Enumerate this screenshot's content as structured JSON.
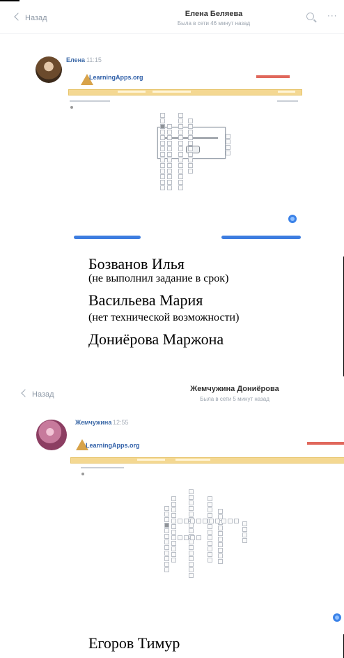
{
  "top_rule": true,
  "chat1": {
    "back_label": "Назад",
    "contact_name": "Елена Беляева",
    "status": "Была в сети 46 минут назад",
    "sender": "Елена",
    "time": "11:15",
    "app_brand": "LearningApps.org"
  },
  "students": {
    "s1_name": "Бозванов Илья",
    "s1_note": "(не выполнил задание в срок)",
    "s2_name": "Васильева Мария",
    "s2_note": "(нет технической возможности)",
    "s3_name": "Дониёрова Маржона",
    "s4_name": "Егоров Тимур"
  },
  "chat2": {
    "back_label": "Назад",
    "contact_name": "Жемчужина Дониёрова",
    "status": "Была в сети 5 минут назад",
    "sender": "Жемчужина",
    "time": "12:55",
    "app_brand": "LearningApps.org"
  },
  "colors": {
    "accent_blue": "#3b82e8",
    "sender_blue": "#3d6aa8",
    "learningapps_bar": "#f4d892"
  },
  "icons": [
    "chevron-left-icon",
    "search-icon",
    "more-icon",
    "phone-icon",
    "learningapps-logo"
  ]
}
